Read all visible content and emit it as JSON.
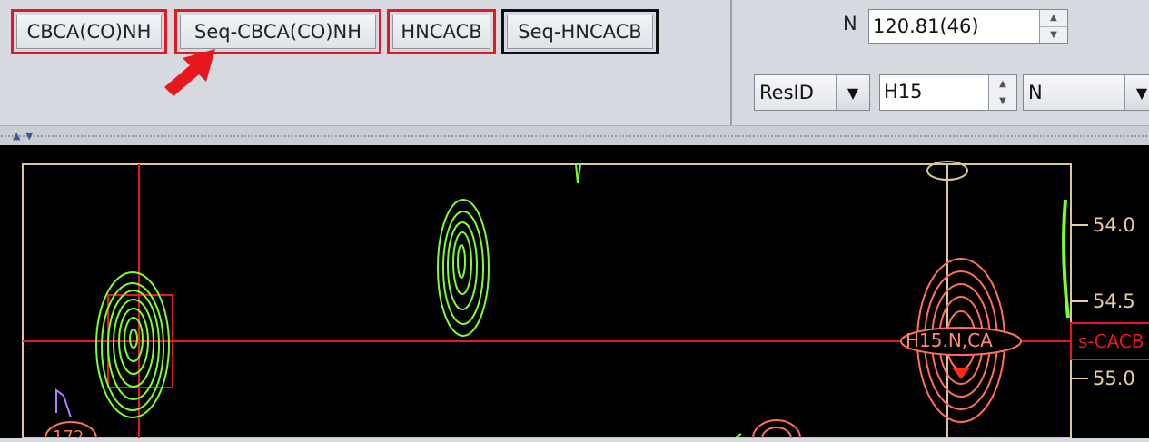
{
  "toolbar": {
    "buttons": [
      {
        "label": "CBCA(CO)NH",
        "outline": "red"
      },
      {
        "label": "Seq-CBCA(CO)NH",
        "outline": "red"
      },
      {
        "label": "HNCACB",
        "outline": "red"
      },
      {
        "label": "Seq-HNCACB",
        "outline": "black"
      }
    ],
    "arrow_icon": "red-arrow-pointer"
  },
  "controls": {
    "n_label": "N",
    "n_value": "120.81(46)",
    "resid_mode": "ResID",
    "resid_value": "H15",
    "atom_select": "N"
  },
  "spectrum": {
    "y_ticks": [
      "54.0",
      "54.5",
      "55.0"
    ],
    "peak_label": "H15.N,CA",
    "edge_tag": "s-CACB",
    "partial_label": "172",
    "colors": {
      "background": "#000000",
      "frame": "#d9c79a",
      "crosshair": "#e8161d",
      "contour_green": "#7cff2a",
      "contour_salmon": "#ff6f57",
      "contour_violet": "#b27cff"
    }
  }
}
